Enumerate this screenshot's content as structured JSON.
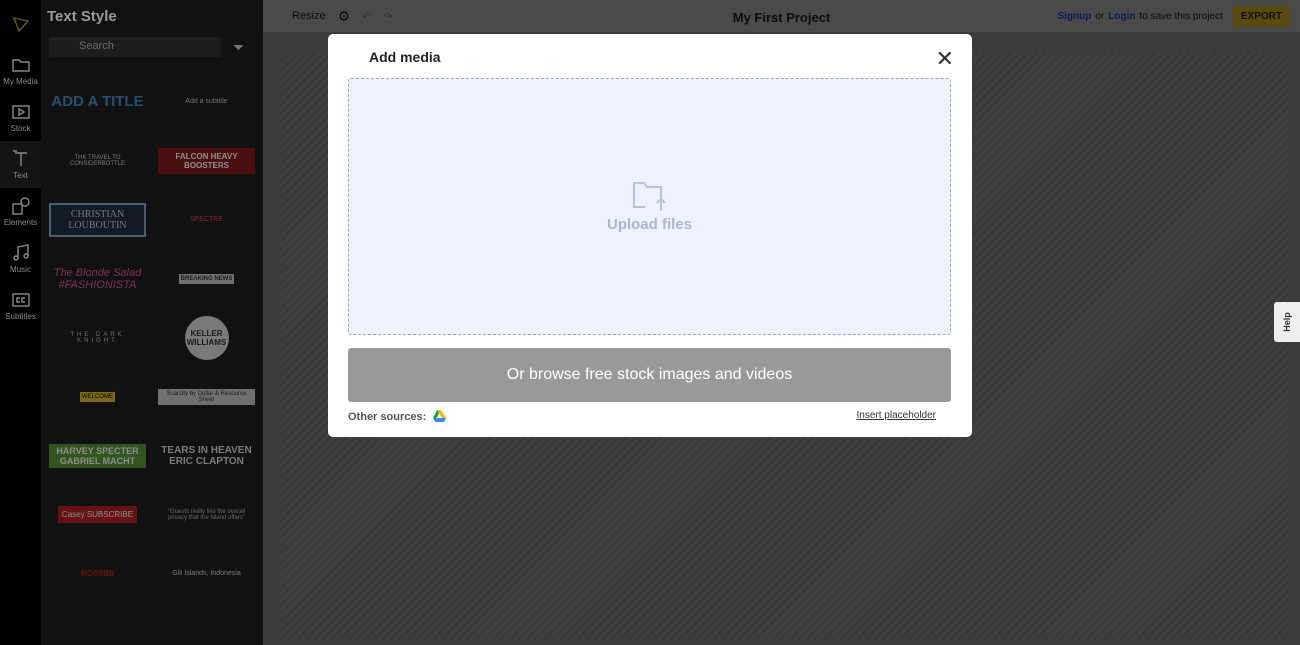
{
  "iconbar": {
    "items": [
      {
        "label": "My Media",
        "icon": "folder-icon"
      },
      {
        "label": "Stock",
        "icon": "stock-video-icon"
      },
      {
        "label": "Text",
        "icon": "text-icon",
        "active": true
      },
      {
        "label": "Elements",
        "icon": "elements-icon"
      },
      {
        "label": "Music",
        "icon": "music-icon"
      },
      {
        "label": "Subtitles",
        "icon": "cc-icon"
      }
    ]
  },
  "panel": {
    "title": "Text Style",
    "search_placeholder": "Search",
    "tiles": [
      "ADD A TITLE",
      "Add a subtitle",
      "THK TRAVEL TO CONSIDERBOTTLE",
      "FALCON HEAVY BOOSTERS",
      "CHRISTIAN LOUBOUTIN",
      "SPECTRE",
      "The Blonde Salad #FASHIONISTA",
      "BREAKING NEWS",
      "THE DARK KNIGHT",
      "KELLER WILLIAMS",
      "WELCOME",
      "Scarcity by Dollar & Resource Sheet",
      "HARVEY SPECTER GABRIEL MACHT",
      "TEARS IN HEAVEN ERIC CLAPTON",
      "Casey SUBSCRIBE",
      "\"Guests really like the overall privacy that the Island offers\"",
      "ROSSINI",
      "Gili Islands, Indonesia"
    ]
  },
  "topbar": {
    "resize": "Resize",
    "title": "My First Project",
    "signup": "Signup",
    "or": "or",
    "login": "Login",
    "save_text": "to save this project",
    "export": "EXPORT"
  },
  "help": "Help",
  "modal": {
    "title": "Add media",
    "upload": "Upload files",
    "browse": "Or browse free stock images and videos",
    "other_sources": "Other sources:",
    "insert_placeholder": "Insert placeholder"
  }
}
